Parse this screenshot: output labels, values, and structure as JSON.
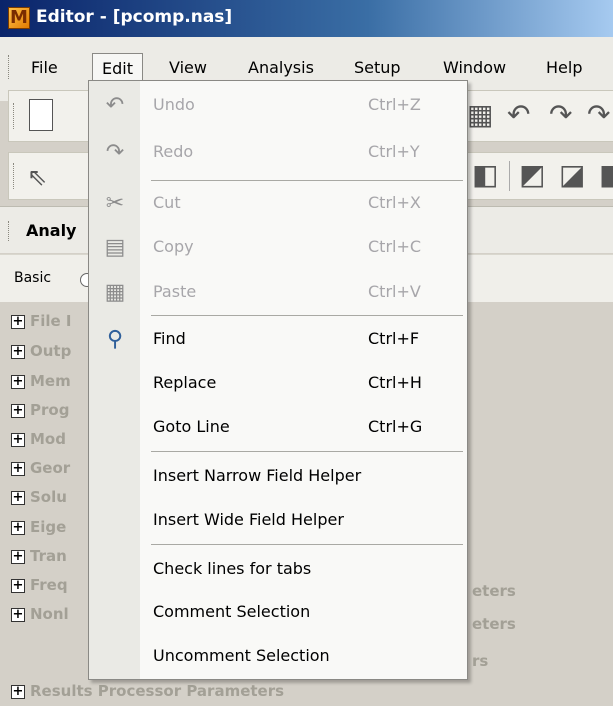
{
  "window": {
    "title": "Editor - [pcomp.nas]"
  },
  "menubar": {
    "items": [
      "File",
      "Edit",
      "View",
      "Analysis",
      "Setup",
      "Window",
      "Help"
    ]
  },
  "panel": {
    "title_partial": "Analy",
    "basic_label": "Basic"
  },
  "tree": {
    "rows": [
      "File I",
      "Outp",
      "Mem",
      "Prog",
      "Mod",
      "Geor",
      "Solu",
      "Eige",
      "Tran",
      "Freq",
      "Nonl",
      "Results Processor Parameters"
    ],
    "tails": [
      "eters",
      "eters",
      "rs"
    ]
  },
  "edit_menu": {
    "items": [
      {
        "label": "Undo",
        "shortcut": "Ctrl+Z",
        "icon": "undo-icon",
        "enabled": false
      },
      {
        "label": "Redo",
        "shortcut": "Ctrl+Y",
        "icon": "redo-icon",
        "enabled": false
      },
      {
        "label": "Cut",
        "shortcut": "Ctrl+X",
        "icon": "scissors-icon",
        "enabled": false
      },
      {
        "label": "Copy",
        "shortcut": "Ctrl+C",
        "icon": "copy-icon",
        "enabled": false
      },
      {
        "label": "Paste",
        "shortcut": "Ctrl+V",
        "icon": "paste-icon",
        "enabled": false
      },
      {
        "label": "Find",
        "shortcut": "Ctrl+F",
        "icon": "magnifier-icon",
        "enabled": true
      },
      {
        "label": "Replace",
        "shortcut": "Ctrl+H",
        "enabled": true
      },
      {
        "label": "Goto Line",
        "shortcut": "Ctrl+G",
        "enabled": true
      },
      {
        "label": "Insert Narrow Field Helper",
        "enabled": true
      },
      {
        "label": "Insert Wide Field Helper",
        "enabled": true
      },
      {
        "label": "Check lines for tabs",
        "enabled": true
      },
      {
        "label": "Comment Selection",
        "enabled": true
      },
      {
        "label": "Uncomment Selection",
        "enabled": true
      }
    ]
  },
  "colors": {
    "titlebar_start": "#0a246a",
    "menu_bg": "#f9f9f7",
    "disabled_text": "#a7a6aa"
  }
}
